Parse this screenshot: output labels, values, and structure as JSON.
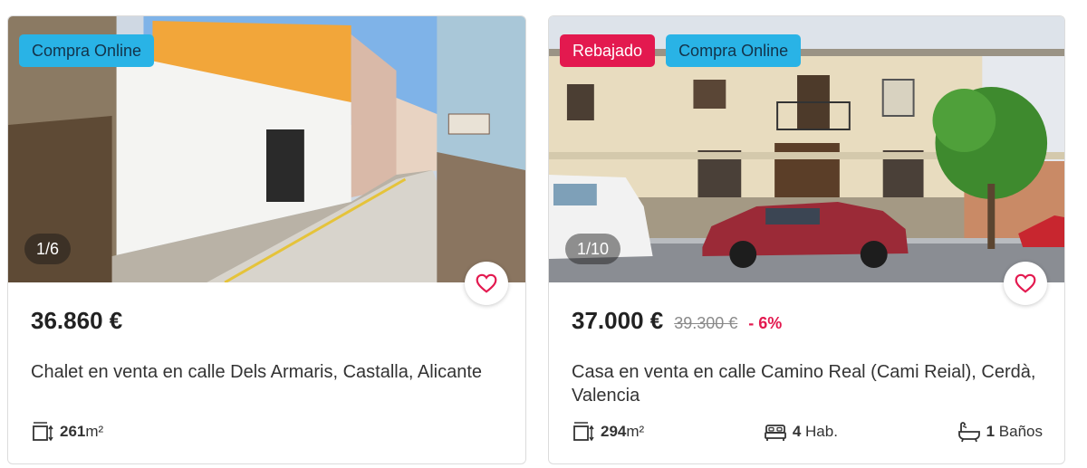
{
  "listings": [
    {
      "badges": {
        "online": "Compra Online"
      },
      "photo_counter": "1/6",
      "price": "36.860 €",
      "title": "Chalet en venta en calle Dels Armaris, Castalla, Alicante",
      "features": {
        "area_value": "261",
        "area_unit": "m²"
      },
      "icons": {
        "favorite": "heart-outline-icon",
        "area": "area-measure-icon"
      }
    },
    {
      "badges": {
        "sale": "Rebajado",
        "online": "Compra Online"
      },
      "photo_counter": "1/10",
      "price": "37.000 €",
      "old_price": "39.300 €",
      "discount": "- 6%",
      "title": "Casa en venta en calle Camino Real (Cami Reial), Cerdà, Valencia",
      "features": {
        "area_value": "294",
        "area_unit": "m²",
        "rooms_value": "4",
        "rooms_label": "Hab.",
        "baths_value": "1",
        "baths_label": "Baños"
      },
      "icons": {
        "favorite": "heart-outline-icon",
        "area": "area-measure-icon",
        "rooms": "bed-icon",
        "baths": "bathtub-icon"
      }
    }
  ],
  "colors": {
    "accent": "#e3194f",
    "online_badge": "#29b3e6",
    "text": "#222222",
    "muted": "#8a8a8a"
  }
}
